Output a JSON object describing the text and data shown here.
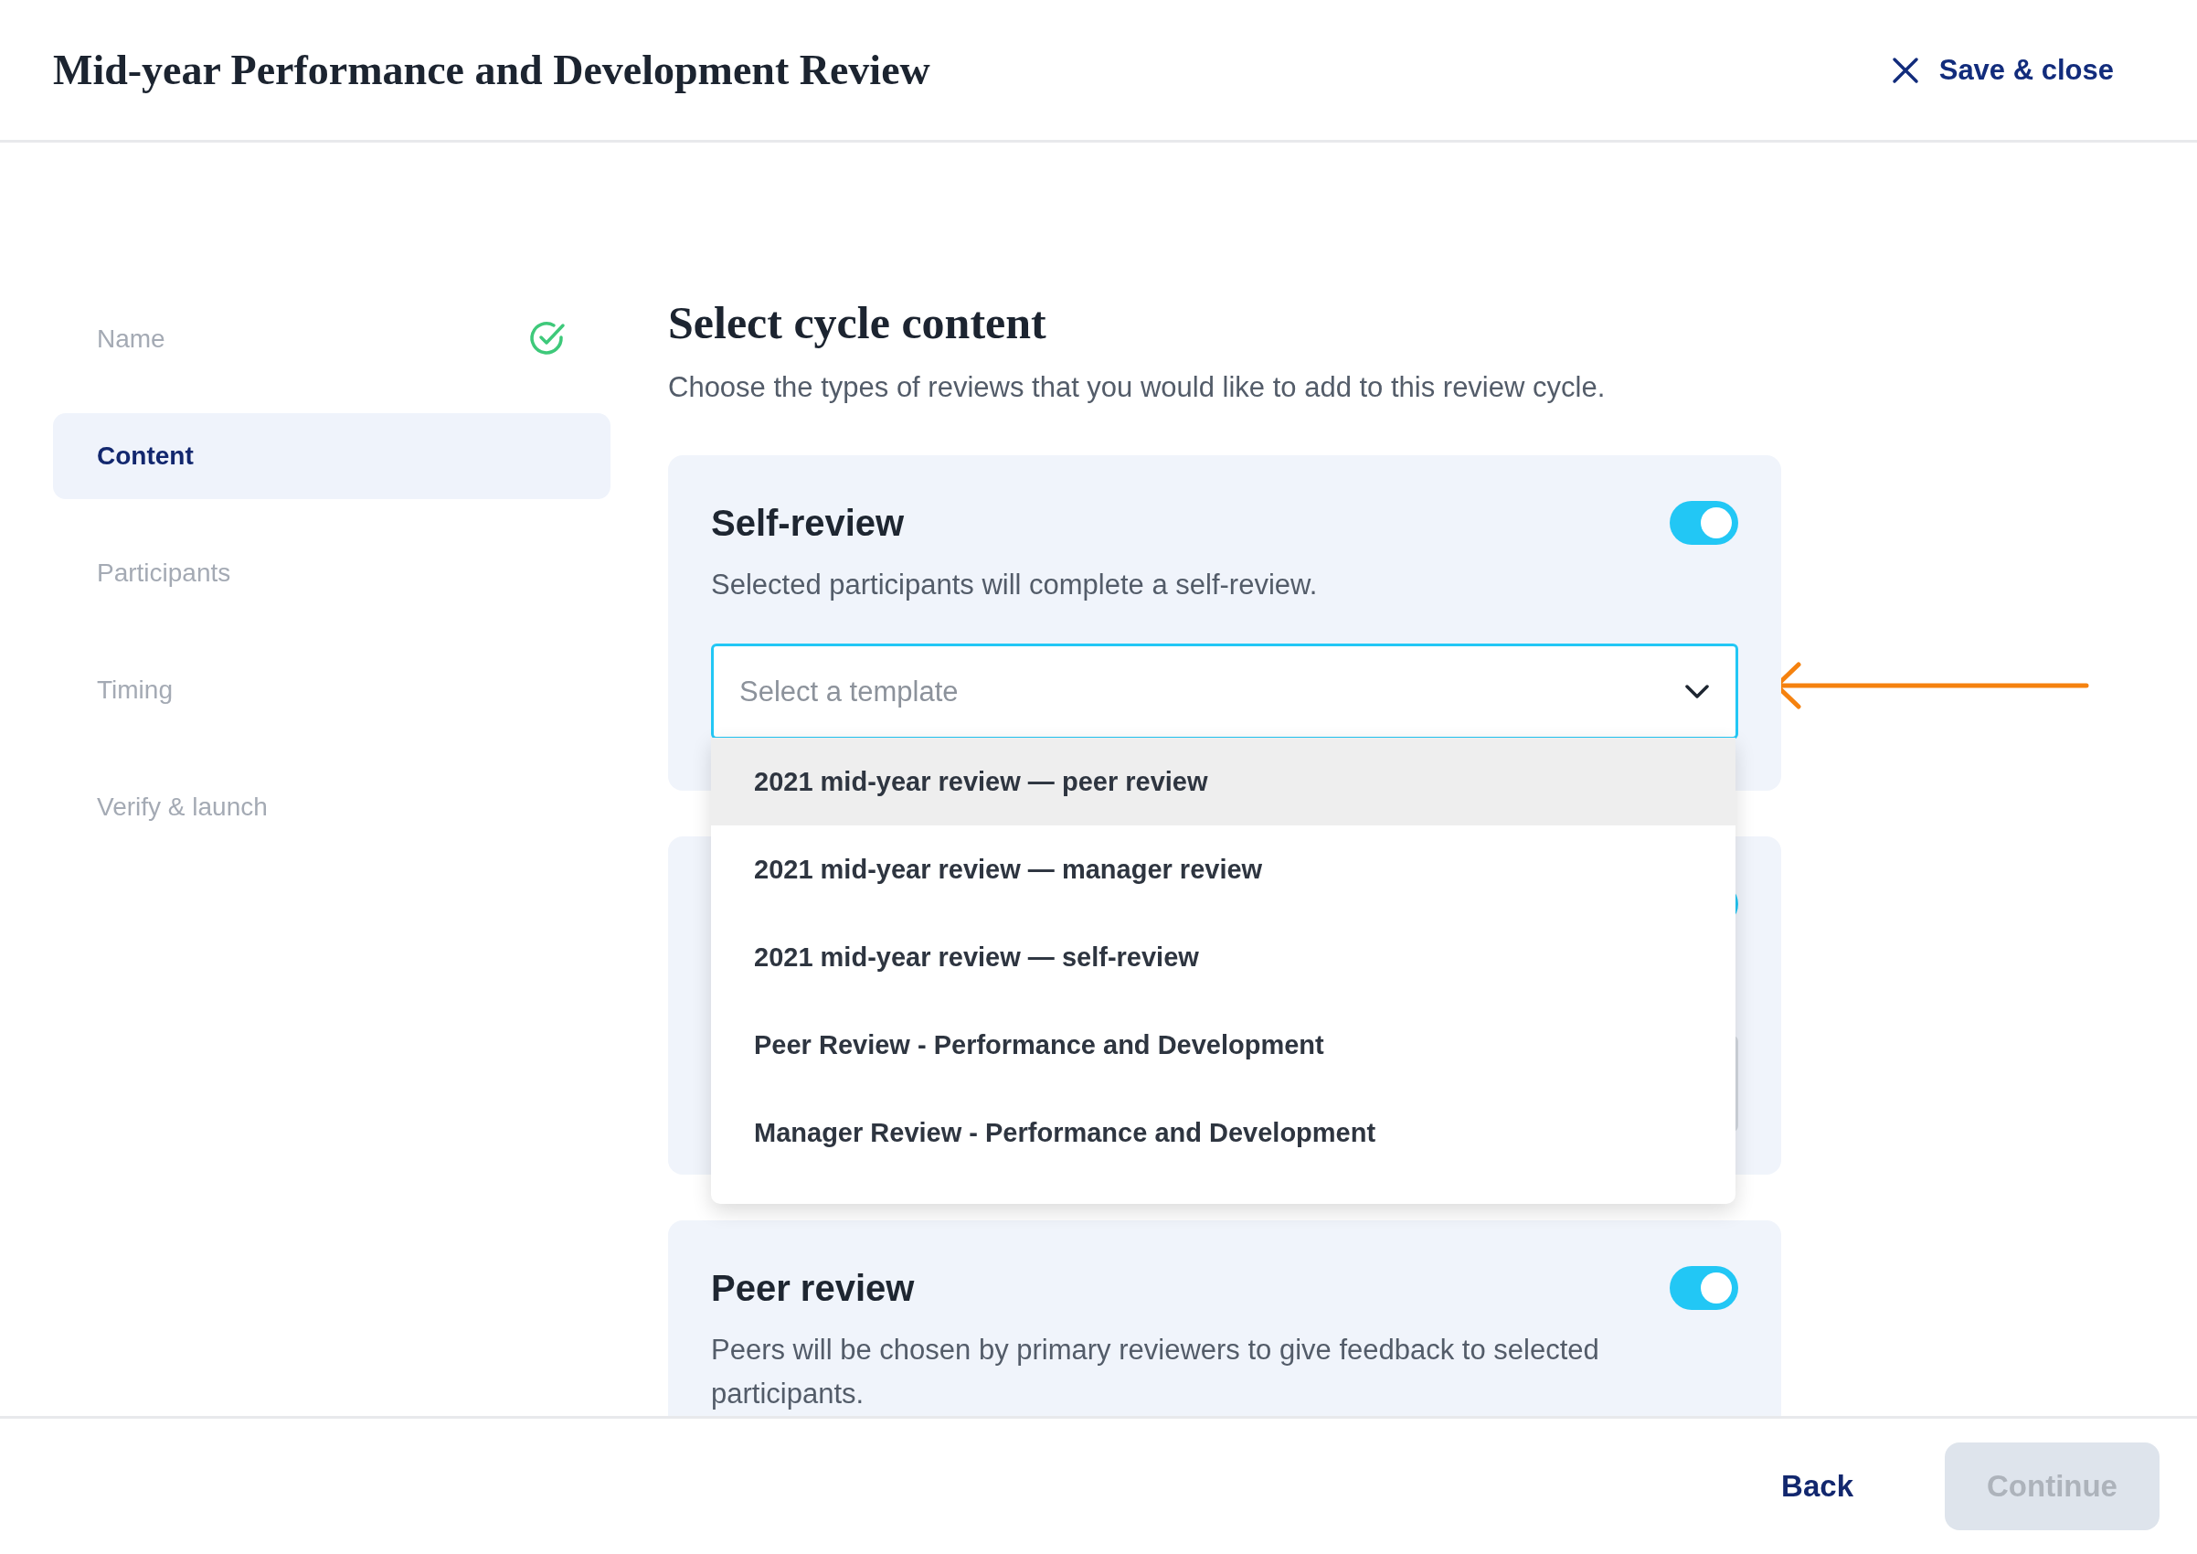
{
  "header": {
    "title": "Mid-year Performance and Development Review",
    "close_label": "Save & close"
  },
  "steps": [
    {
      "label": "Name",
      "selected": false,
      "completed": true
    },
    {
      "label": "Content",
      "selected": true,
      "completed": false
    },
    {
      "label": "Participants",
      "selected": false,
      "completed": false
    },
    {
      "label": "Timing",
      "selected": false,
      "completed": false
    },
    {
      "label": "Verify & launch",
      "selected": false,
      "completed": false
    }
  ],
  "content": {
    "title": "Select cycle content",
    "subtitle": "Choose the types of reviews that you would like to add to this review cycle.",
    "cards": [
      {
        "kind": "template",
        "title": "Self-review",
        "description": "Selected participants will complete a self-review.",
        "on": true,
        "placeholder": "Select a template",
        "expanded": true
      },
      {
        "kind": "template",
        "on": true,
        "expanded": false
      },
      {
        "kind": "basic",
        "title": "Peer review",
        "description": "Peers will be chosen by primary reviewers to give feedback to selected participants.",
        "on": true
      }
    ],
    "template_options": [
      {
        "label": "2021 mid-year review — peer review",
        "selected": true
      },
      {
        "label": "2021 mid-year review — manager review",
        "selected": false
      },
      {
        "label": "2021 mid-year review — self-review",
        "selected": false
      },
      {
        "label": "Peer Review - Performance and Development",
        "selected": false
      },
      {
        "label": "Manager Review - Performance and Development",
        "selected": false
      }
    ]
  },
  "footer": {
    "back_label": "Back",
    "continue_label": "Continue",
    "continue_disabled": true
  }
}
